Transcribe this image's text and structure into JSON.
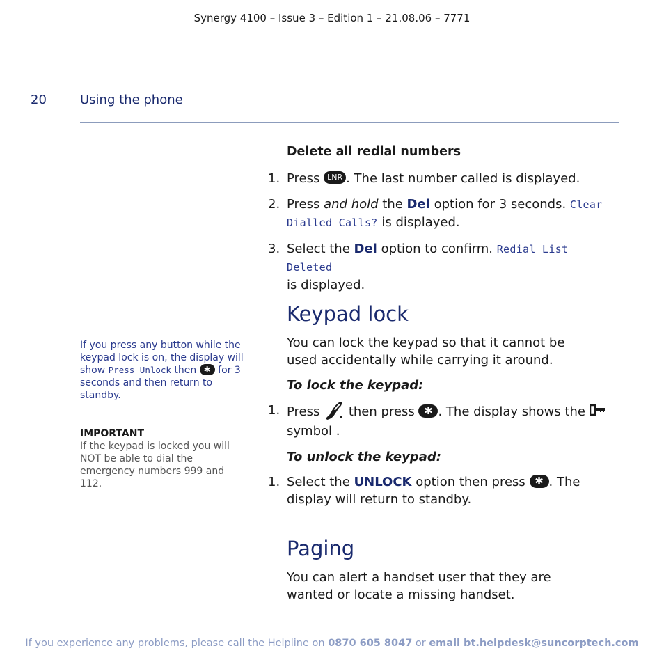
{
  "header": {
    "doc_id": "Synergy 4100 – Issue 3 – Edition 1 – 21.08.06 – 7771",
    "page_number": "20",
    "section_title": "Using the phone"
  },
  "delete_redial": {
    "title": "Delete all redial numbers",
    "steps": [
      {
        "num": "1.",
        "pre": "Press ",
        "icon": "LNR",
        "post": ". The last number called is displayed."
      },
      {
        "num": "2.",
        "pre": "Press ",
        "italic": "and hold",
        "mid": " the ",
        "kw": "Del",
        "post": " option for 3 seconds. ",
        "lcd": "Clear Dialled Calls?",
        "end": " is displayed."
      },
      {
        "num": "3.",
        "pre": "Select the ",
        "kw": "Del",
        "post": " option to confirm. ",
        "lcd": "Redial List Deleted",
        "end": " is displayed."
      }
    ]
  },
  "keypad_lock": {
    "heading": "Keypad lock",
    "intro": "You can lock the keypad so that it cannot be used accidentally while carrying it around.",
    "lock_subhead": "To lock the keypad:",
    "lock_step": {
      "num": "1.",
      "pre": "Press ",
      "mid": " then press ",
      "post": ". The display shows the ",
      "end": " symbol ."
    },
    "unlock_subhead": "To unlock the keypad:",
    "unlock_step": {
      "num": "1.",
      "pre": "Select the ",
      "kw": "UNLOCK",
      "mid": " option then press ",
      "post": ". The display will return to standby."
    },
    "star_glyph": "✱"
  },
  "paging": {
    "heading": "Paging",
    "intro": "You can alert a handset user that they are wanted or locate a missing handset."
  },
  "sidebar": {
    "note_pre": "If you press any button while the keypad lock is on, the display will show ",
    "note_lcd": "Press Unlock",
    "note_mid": " then ",
    "note_post": " for 3 seconds and then return to standby.",
    "important_title": "IMPORTANT",
    "important_text": "If the keypad is locked you will NOT be able to dial the emergency numbers 999 and 112."
  },
  "footer": {
    "pre": "If you experience any problems, please call the Helpline on ",
    "phone": "0870 605 8047",
    "mid": " or ",
    "email": "email bt.helpdesk@suncorptech.com"
  }
}
